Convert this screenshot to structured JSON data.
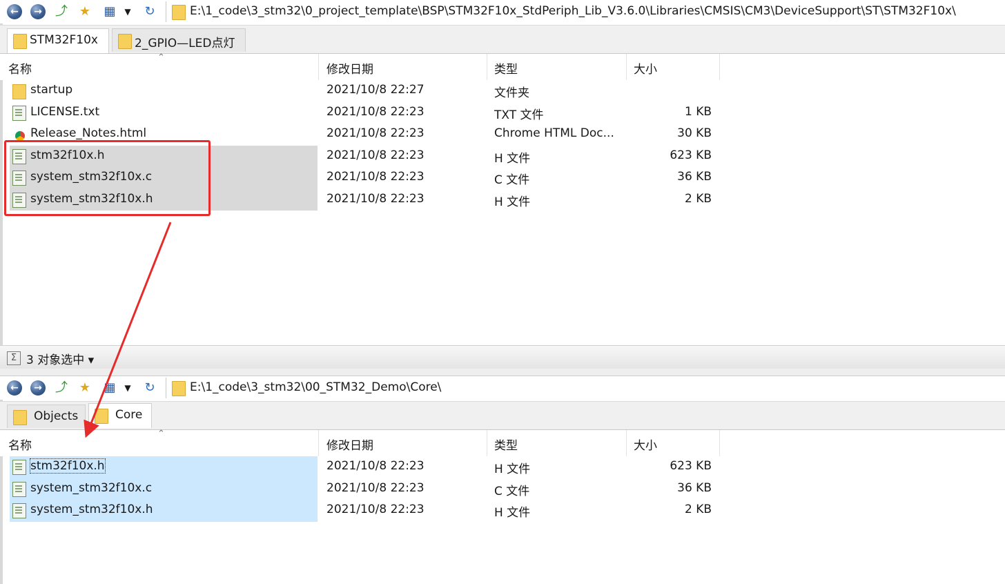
{
  "top_pane": {
    "address": "E:\\1_code\\3_stm32\\0_project_template\\BSP\\STM32F10x_StdPeriph_Lib_V3.6.0\\Libraries\\CMSIS\\CM3\\DeviceSupport\\ST\\STM32F10x\\",
    "tabs": [
      {
        "label": "STM32F10x",
        "active": true
      },
      {
        "label": "2_GPIO—LED点灯",
        "active": false
      }
    ],
    "columns": {
      "name": "名称",
      "date": "修改日期",
      "type": "类型",
      "size": "大小"
    },
    "rows": [
      {
        "icon": "folder-icon",
        "name": "startup",
        "date": "2021/10/8 22:27",
        "type": "文件夹",
        "size": "",
        "selected": false
      },
      {
        "icon": "text-file-icon",
        "name": "LICENSE.txt",
        "date": "2021/10/8 22:23",
        "type": "TXT 文件",
        "size": "1 KB",
        "selected": false
      },
      {
        "icon": "chrome-file-icon",
        "name": "Release_Notes.html",
        "date": "2021/10/8 22:23",
        "type": "Chrome HTML Doc...",
        "size": "30 KB",
        "selected": false
      },
      {
        "icon": "code-file-icon",
        "name": "stm32f10x.h",
        "date": "2021/10/8 22:23",
        "type": "H 文件",
        "size": "623 KB",
        "selected": true
      },
      {
        "icon": "code-file-icon",
        "name": "system_stm32f10x.c",
        "date": "2021/10/8 22:23",
        "type": "C 文件",
        "size": "36 KB",
        "selected": true
      },
      {
        "icon": "code-file-icon",
        "name": "system_stm32f10x.h",
        "date": "2021/10/8 22:23",
        "type": "H 文件",
        "size": "2 KB",
        "selected": true
      }
    ],
    "status": "3 对象选中 ▾"
  },
  "bottom_pane": {
    "address": "E:\\1_code\\3_stm32\\00_STM32_Demo\\Core\\",
    "tabs": [
      {
        "label": "Objects",
        "active": false
      },
      {
        "label": "Core",
        "active": true
      }
    ],
    "columns": {
      "name": "名称",
      "date": "修改日期",
      "type": "类型",
      "size": "大小"
    },
    "rows": [
      {
        "icon": "code-file-icon",
        "name": "stm32f10x.h",
        "date": "2021/10/8 22:23",
        "type": "H 文件",
        "size": "623 KB",
        "selected": true
      },
      {
        "icon": "code-file-icon",
        "name": "system_stm32f10x.c",
        "date": "2021/10/8 22:23",
        "type": "C 文件",
        "size": "36 KB",
        "selected": true
      },
      {
        "icon": "code-file-icon",
        "name": "system_stm32f10x.h",
        "date": "2021/10/8 22:23",
        "type": "H 文件",
        "size": "2 KB",
        "selected": true
      }
    ]
  },
  "toolbar_icons": [
    "back-icon",
    "forward-icon",
    "up-folder-icon",
    "new-folder-icon",
    "view-mode-icon",
    "dropdown-icon",
    "refresh-icon"
  ],
  "colors": {
    "annotation": "#e62b2b",
    "selection_inactive": "#d9d9d9",
    "selection_active": "#cce8ff",
    "folder": "#f7cf5b"
  }
}
